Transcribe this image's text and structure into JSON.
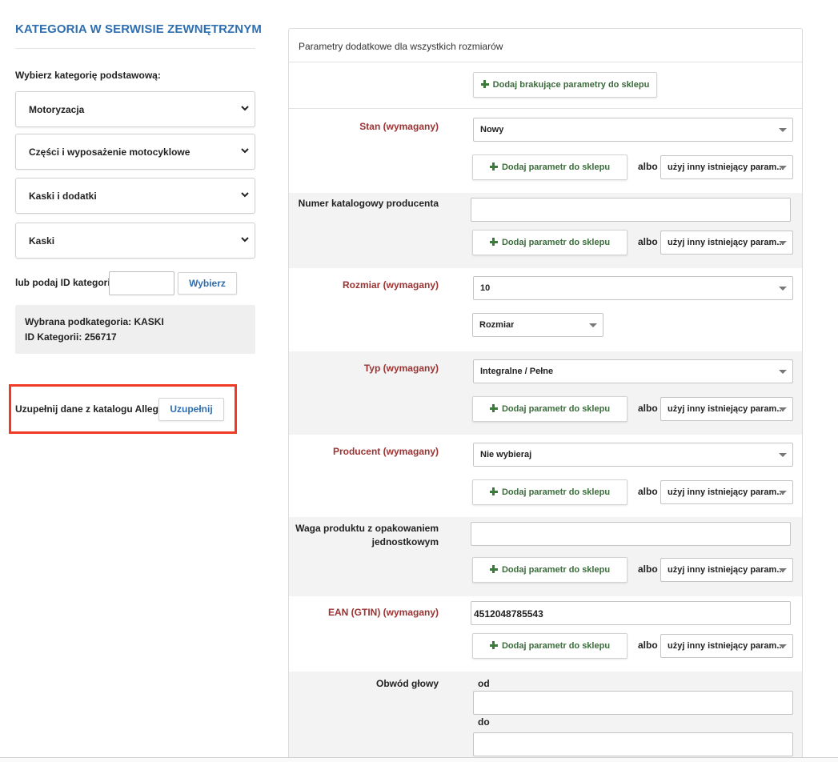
{
  "left": {
    "title": "KATEGORIA W SERWISIE ZEWNĘTRZNYM",
    "choose_label": "Wybierz kategorię podstawową:",
    "selects": [
      "Motoryzacja",
      "Części i wyposażenie motocyklowe",
      "Kaski i dodatki",
      "Kaski"
    ],
    "id_label": "lub podaj ID kategorii:",
    "id_value": "",
    "choose_button": "Wybierz",
    "selected_sub": "Wybrana podkategoria: KASKI",
    "selected_id": "ID Kategorii: 256717",
    "fill_label": "Uzupełnij dane z katalogu Allegro",
    "fill_button": "Uzupełnij"
  },
  "panel": {
    "title": "Parametry dodatkowe dla wszystkich rozmiarów",
    "add_missing": "Dodaj brakujące parametry do sklepu",
    "add_param": "Dodaj parametr do sklepu",
    "albo": "albo",
    "use_other": "użyj inny istniejący param...",
    "params": {
      "stan": {
        "label": "Stan (wymagany)",
        "value": "Nowy"
      },
      "numer": {
        "label": "Numer katalogowy producenta",
        "value": ""
      },
      "rozmiar": {
        "label": "Rozmiar (wymagany)",
        "value": "10",
        "secondary": "Rozmiar"
      },
      "typ": {
        "label": "Typ (wymagany)",
        "value": "Integralne / Pełne"
      },
      "producent": {
        "label": "Producent (wymagany)",
        "value": "Nie wybieraj"
      },
      "waga": {
        "label_line1": "Waga produktu z opakowaniem",
        "label_line2": "jednostkowym",
        "value": ""
      },
      "ean": {
        "label": "EAN (GTIN) (wymagany)",
        "value": "4512048785543"
      },
      "obwod": {
        "label": "Obwód głowy",
        "od": "od",
        "do": "do",
        "od_value": "",
        "do_value": ""
      }
    }
  },
  "colors": {
    "accent": "#2f6fb0",
    "required": "#9b3333",
    "add_green": "#3c7a3c",
    "highlight": "#f03a24"
  }
}
